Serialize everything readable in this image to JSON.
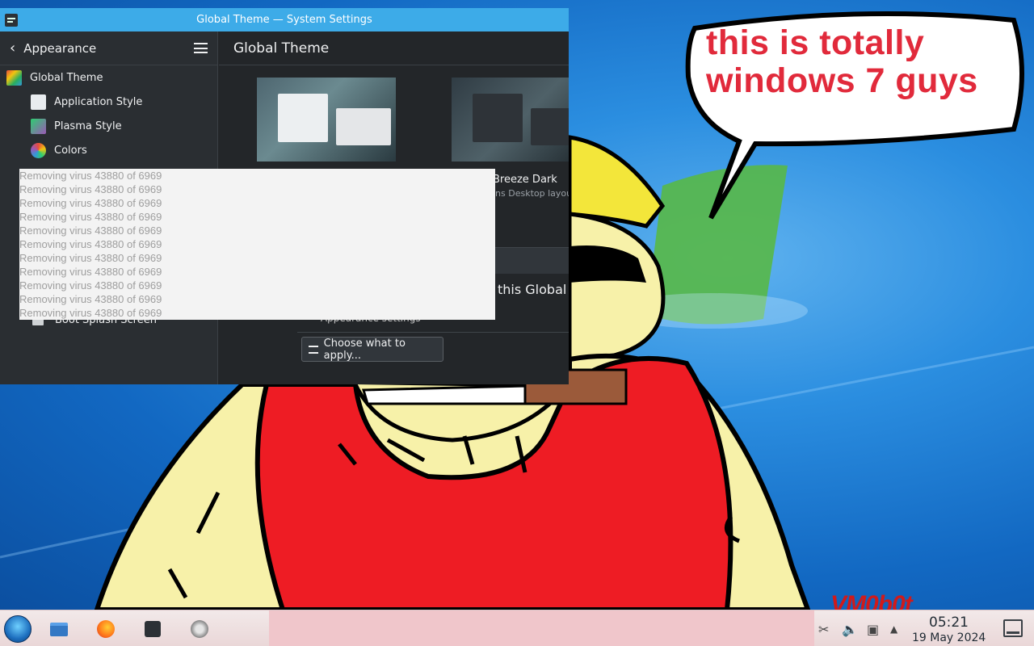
{
  "window": {
    "title": "Global Theme — System Settings"
  },
  "sidebar": {
    "back_label": "Appearance",
    "items": [
      {
        "label": "Global Theme"
      },
      {
        "label": "Application Style"
      },
      {
        "label": "Plasma Style"
      },
      {
        "label": "Colors"
      }
    ],
    "partial_item": "Boot Splash Screen"
  },
  "main": {
    "title": "Global Theme",
    "theme2_name": "Breeze Dark",
    "theme2_subtitle": "ins Desktop layou",
    "apply_text_partial": "this Global T",
    "appearance_link_partial": "• Appearance settings",
    "choose_button": "Choose what to apply..."
  },
  "popup": {
    "lines": [
      "Removing virus 43880 of 6969",
      "Removing virus 43880 of 6969",
      "Removing virus 43880 of 6969",
      "Removing virus 43880 of 6969",
      "Removing virus 43880 of 6969",
      "Removing virus 43880 of 6969",
      "Removing virus 43880 of 6969",
      "Removing virus 43880 of 6969",
      "Removing virus 43880 of 6969",
      "Removing virus 43880 of 6969",
      "Removing virus 43880 of 6969"
    ]
  },
  "wallpaper": {
    "bubble_line1": "this is totally",
    "bubble_line2": "windows 7 guys",
    "signature": "VM0b0t"
  },
  "taskbar": {
    "time": "05:21",
    "date": "19 May 2024",
    "icons": [
      "start-menu-icon",
      "file-manager-icon",
      "firefox-icon",
      "system-settings-icon",
      "clock-app-icon"
    ],
    "tray_icons": [
      "scissors-icon",
      "volume-icon",
      "clipboard-icon",
      "chevron-up-icon"
    ]
  },
  "colors": {
    "titlebar": "#3dabe8",
    "window_bg": "#232629",
    "bubble_text": "#e12a3b",
    "taskbar_mid": "#f0c6cb"
  }
}
